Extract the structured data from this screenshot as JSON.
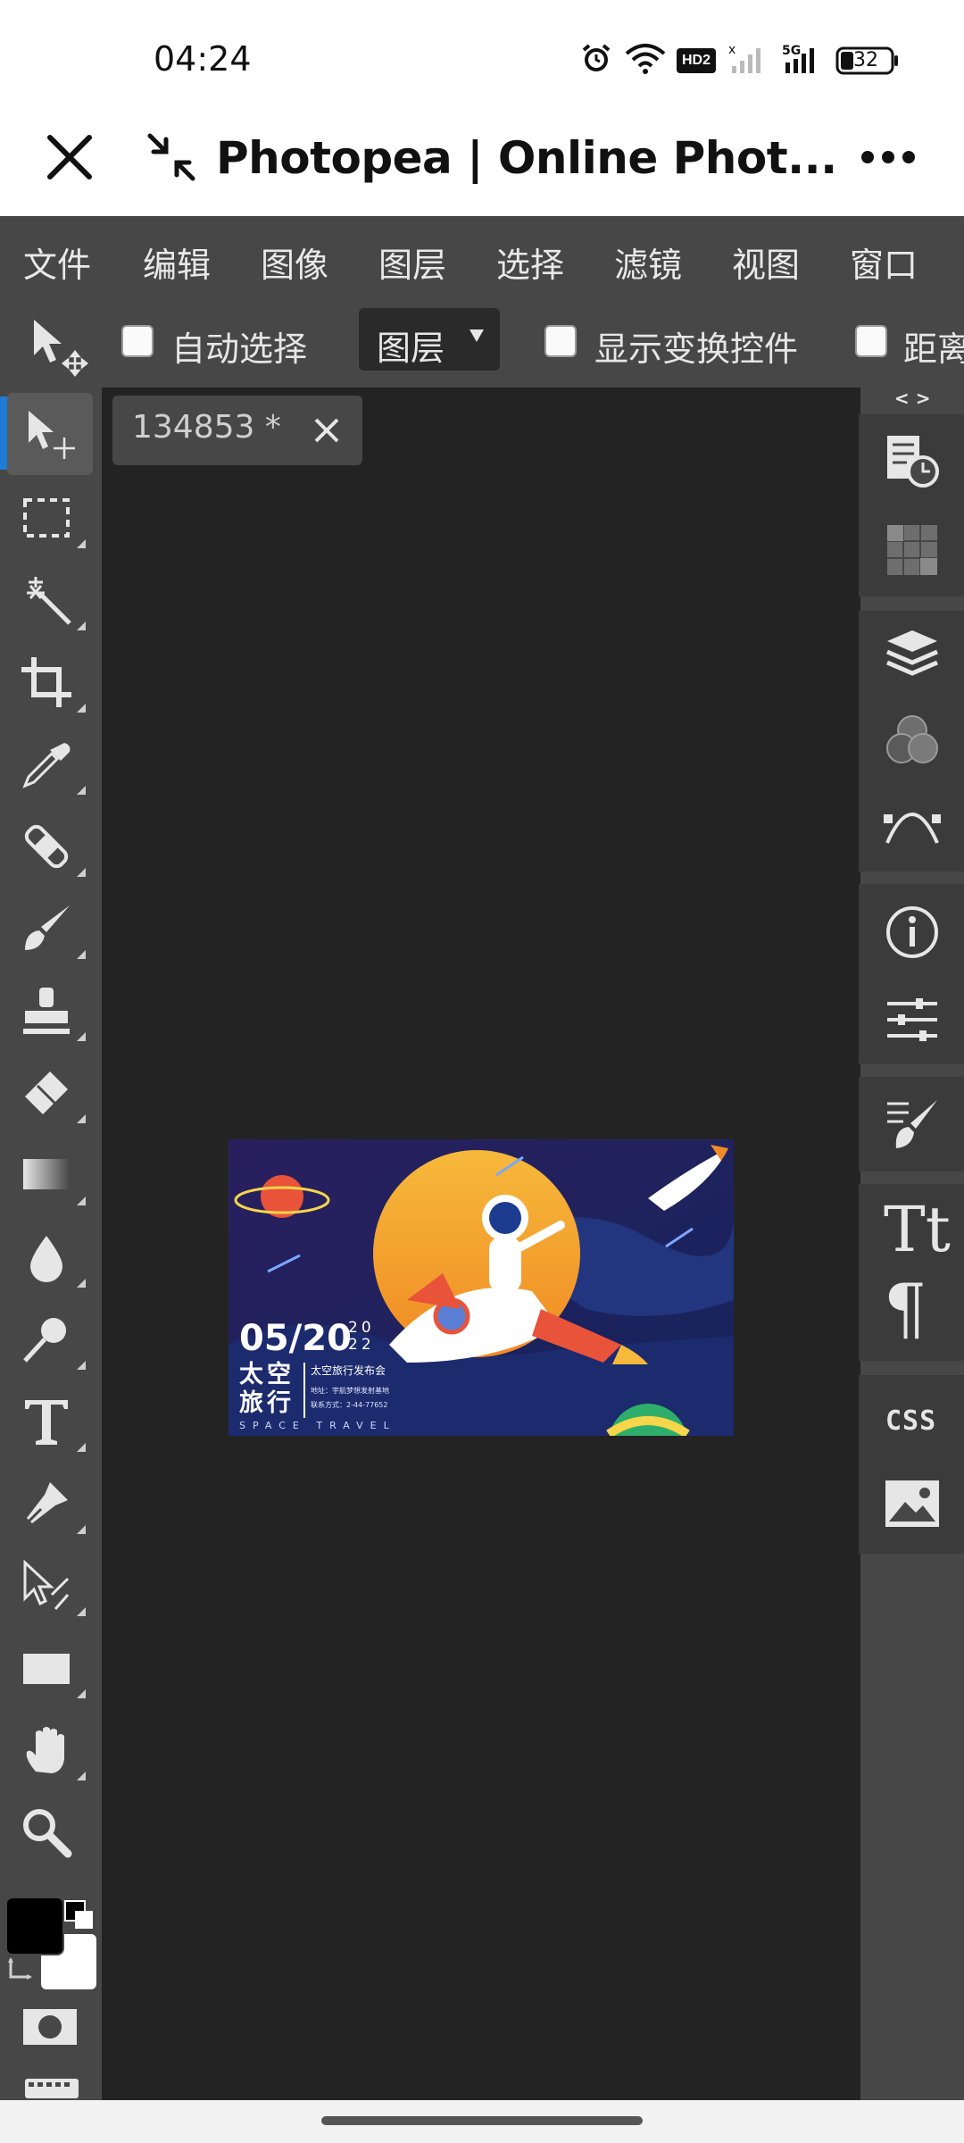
{
  "status_bar": {
    "time": "04:24",
    "battery": "32",
    "hd_badge": "HD2",
    "network": "5G",
    "icons": [
      "alarm-icon",
      "wifi-icon",
      "hd-icon",
      "signal-off-icon",
      "signal-5g-icon",
      "battery-icon"
    ]
  },
  "browser": {
    "title": "Photopea | Online Phot...",
    "close_icon": "close-icon",
    "minimize_icon": "shrink-icon",
    "more_icon": "more-icon"
  },
  "menu": {
    "items": [
      "文件",
      "编辑",
      "图像",
      "图层",
      "选择",
      "滤镜",
      "视图",
      "窗口"
    ]
  },
  "options_bar": {
    "auto_select_label": "自动选择",
    "auto_select_checked": false,
    "layer_select_value": "图层",
    "show_transform_label": "显示变换控件",
    "show_transform_checked": false,
    "distance_label": "距离"
  },
  "tools": [
    "move-tool",
    "marquee-tool",
    "magic-wand-tool",
    "crop-tool",
    "eyedropper-tool",
    "healing-tool",
    "brush-tool",
    "clone-stamp-tool",
    "eraser-tool",
    "gradient-tool",
    "blur-tool",
    "dodge-tool",
    "type-tool",
    "pen-tool",
    "path-select-tool",
    "shape-tool",
    "hand-tool",
    "zoom-tool"
  ],
  "colors": {
    "foreground": "#000000",
    "background": "#ffffff",
    "app_bg": "#474747",
    "canvas_bg": "#232323",
    "accent": "#1e7bd6"
  },
  "document": {
    "tab_name": "134853 *",
    "close_icon": "close-icon"
  },
  "artwork": {
    "date": "05/20",
    "year": "2022",
    "title": "太空旅行",
    "subtitle": "太空旅行发布会",
    "address": "地址：宇航梦想发射基地",
    "contact": "联系方式：2-44-77652",
    "english": "SPACE TRAVEL"
  },
  "right_panel": {
    "collapse_label": "< >",
    "css_label": "CSS",
    "icons": [
      "history-icon",
      "swatches-icon",
      "layers-icon",
      "channels-icon",
      "paths-icon",
      "info-icon",
      "adjustments-icon",
      "brush-settings-icon",
      "character-icon",
      "paragraph-icon",
      "css-icon",
      "image-icon"
    ]
  }
}
